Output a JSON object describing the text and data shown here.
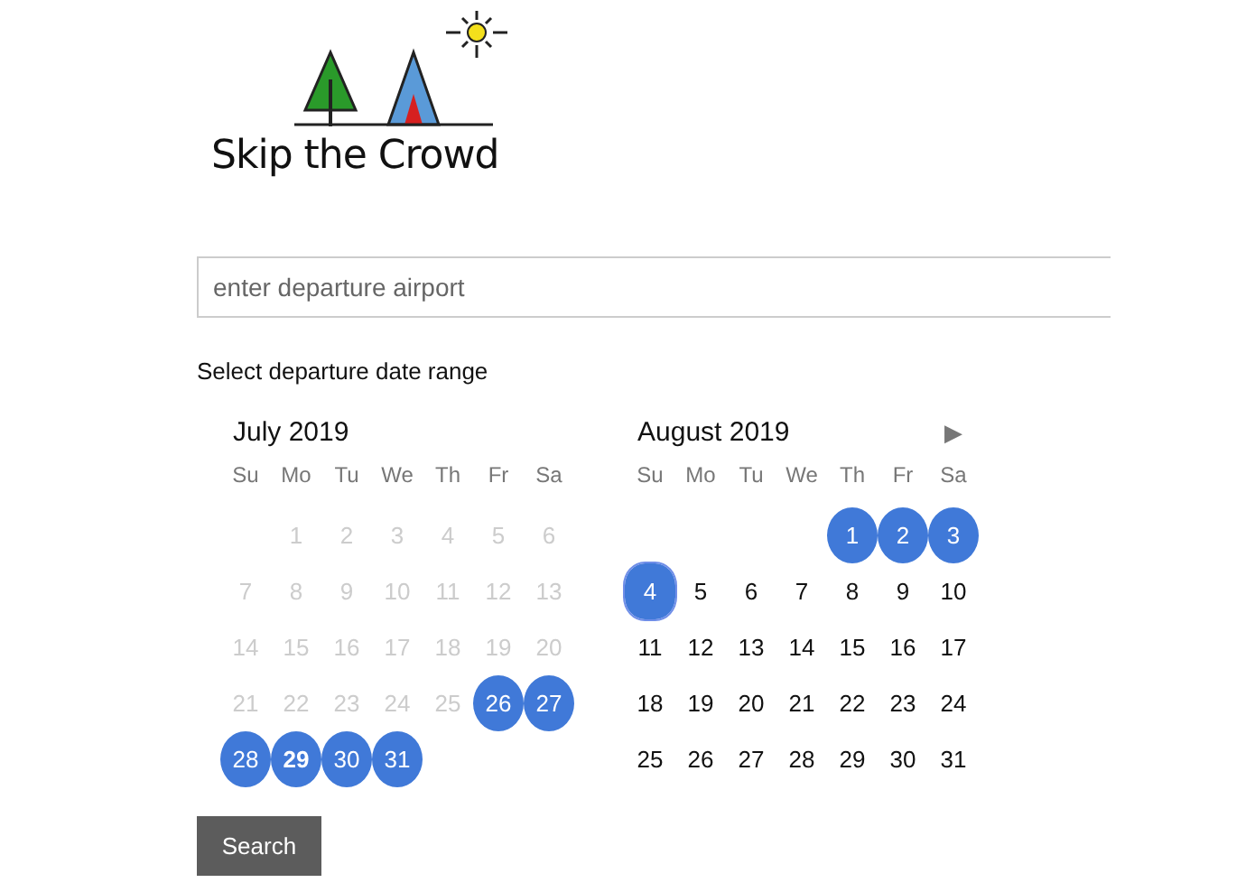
{
  "logo": {
    "text": "Skip the Crowd"
  },
  "airport_field": {
    "placeholder": "enter departure airport"
  },
  "date_label": "Select departure date range",
  "next_button": "▶",
  "months": [
    {
      "title": "July 2019",
      "weekdays": [
        "Su",
        "Mo",
        "Tu",
        "We",
        "Th",
        "Fr",
        "Sa"
      ],
      "weeks": [
        [
          {
            "label": "1",
            "disabled": true,
            "selected": false,
            "today": false,
            "focused": false
          },
          {
            "label": "2",
            "disabled": true,
            "selected": false,
            "today": false,
            "focused": false
          },
          {
            "label": "3",
            "disabled": true,
            "selected": false,
            "today": false,
            "focused": false
          },
          {
            "label": "4",
            "disabled": true,
            "selected": false,
            "today": false,
            "focused": false
          },
          {
            "label": "5",
            "disabled": true,
            "selected": false,
            "today": false,
            "focused": false
          },
          {
            "label": "6",
            "disabled": true,
            "selected": false,
            "today": false,
            "focused": false
          }
        ],
        [
          {
            "label": "7",
            "disabled": true,
            "selected": false,
            "today": false,
            "focused": false
          },
          {
            "label": "8",
            "disabled": true,
            "selected": false,
            "today": false,
            "focused": false
          },
          {
            "label": "9",
            "disabled": true,
            "selected": false,
            "today": false,
            "focused": false
          },
          {
            "label": "10",
            "disabled": true,
            "selected": false,
            "today": false,
            "focused": false
          },
          {
            "label": "11",
            "disabled": true,
            "selected": false,
            "today": false,
            "focused": false
          },
          {
            "label": "12",
            "disabled": true,
            "selected": false,
            "today": false,
            "focused": false
          },
          {
            "label": "13",
            "disabled": true,
            "selected": false,
            "today": false,
            "focused": false
          }
        ],
        [
          {
            "label": "14",
            "disabled": true,
            "selected": false,
            "today": false,
            "focused": false
          },
          {
            "label": "15",
            "disabled": true,
            "selected": false,
            "today": false,
            "focused": false
          },
          {
            "label": "16",
            "disabled": true,
            "selected": false,
            "today": false,
            "focused": false
          },
          {
            "label": "17",
            "disabled": true,
            "selected": false,
            "today": false,
            "focused": false
          },
          {
            "label": "18",
            "disabled": true,
            "selected": false,
            "today": false,
            "focused": false
          },
          {
            "label": "19",
            "disabled": true,
            "selected": false,
            "today": false,
            "focused": false
          },
          {
            "label": "20",
            "disabled": true,
            "selected": false,
            "today": false,
            "focused": false
          }
        ],
        [
          {
            "label": "21",
            "disabled": true,
            "selected": false,
            "today": false,
            "focused": false
          },
          {
            "label": "22",
            "disabled": true,
            "selected": false,
            "today": false,
            "focused": false
          },
          {
            "label": "23",
            "disabled": true,
            "selected": false,
            "today": false,
            "focused": false
          },
          {
            "label": "24",
            "disabled": true,
            "selected": false,
            "today": false,
            "focused": false
          },
          {
            "label": "25",
            "disabled": true,
            "selected": false,
            "today": false,
            "focused": false
          },
          {
            "label": "26",
            "disabled": false,
            "selected": true,
            "today": false,
            "focused": false
          },
          {
            "label": "27",
            "disabled": false,
            "selected": true,
            "today": false,
            "focused": false
          }
        ],
        [
          {
            "label": "28",
            "disabled": false,
            "selected": true,
            "today": false,
            "focused": false
          },
          {
            "label": "29",
            "disabled": false,
            "selected": true,
            "today": true,
            "focused": false
          },
          {
            "label": "30",
            "disabled": false,
            "selected": true,
            "today": false,
            "focused": false
          },
          {
            "label": "31",
            "disabled": false,
            "selected": true,
            "today": false,
            "focused": false
          }
        ]
      ]
    },
    {
      "title": "August 2019",
      "weekdays": [
        "Su",
        "Mo",
        "Tu",
        "We",
        "Th",
        "Fr",
        "Sa"
      ],
      "weeks": [
        [
          {
            "label": "1",
            "disabled": false,
            "selected": true,
            "today": false,
            "focused": false
          },
          {
            "label": "2",
            "disabled": false,
            "selected": true,
            "today": false,
            "focused": false
          },
          {
            "label": "3",
            "disabled": false,
            "selected": true,
            "today": false,
            "focused": false
          }
        ],
        [
          {
            "label": "4",
            "disabled": false,
            "selected": true,
            "today": false,
            "focused": true
          },
          {
            "label": "5",
            "disabled": false,
            "selected": false,
            "today": false,
            "focused": false
          },
          {
            "label": "6",
            "disabled": false,
            "selected": false,
            "today": false,
            "focused": false
          },
          {
            "label": "7",
            "disabled": false,
            "selected": false,
            "today": false,
            "focused": false
          },
          {
            "label": "8",
            "disabled": false,
            "selected": false,
            "today": false,
            "focused": false
          },
          {
            "label": "9",
            "disabled": false,
            "selected": false,
            "today": false,
            "focused": false
          },
          {
            "label": "10",
            "disabled": false,
            "selected": false,
            "today": false,
            "focused": false
          }
        ],
        [
          {
            "label": "11",
            "disabled": false,
            "selected": false,
            "today": false,
            "focused": false
          },
          {
            "label": "12",
            "disabled": false,
            "selected": false,
            "today": false,
            "focused": false
          },
          {
            "label": "13",
            "disabled": false,
            "selected": false,
            "today": false,
            "focused": false
          },
          {
            "label": "14",
            "disabled": false,
            "selected": false,
            "today": false,
            "focused": false
          },
          {
            "label": "15",
            "disabled": false,
            "selected": false,
            "today": false,
            "focused": false
          },
          {
            "label": "16",
            "disabled": false,
            "selected": false,
            "today": false,
            "focused": false
          },
          {
            "label": "17",
            "disabled": false,
            "selected": false,
            "today": false,
            "focused": false
          }
        ],
        [
          {
            "label": "18",
            "disabled": false,
            "selected": false,
            "today": false,
            "focused": false
          },
          {
            "label": "19",
            "disabled": false,
            "selected": false,
            "today": false,
            "focused": false
          },
          {
            "label": "20",
            "disabled": false,
            "selected": false,
            "today": false,
            "focused": false
          },
          {
            "label": "21",
            "disabled": false,
            "selected": false,
            "today": false,
            "focused": false
          },
          {
            "label": "22",
            "disabled": false,
            "selected": false,
            "today": false,
            "focused": false
          },
          {
            "label": "23",
            "disabled": false,
            "selected": false,
            "today": false,
            "focused": false
          },
          {
            "label": "24",
            "disabled": false,
            "selected": false,
            "today": false,
            "focused": false
          }
        ],
        [
          {
            "label": "25",
            "disabled": false,
            "selected": false,
            "today": false,
            "focused": false
          },
          {
            "label": "26",
            "disabled": false,
            "selected": false,
            "today": false,
            "focused": false
          },
          {
            "label": "27",
            "disabled": false,
            "selected": false,
            "today": false,
            "focused": false
          },
          {
            "label": "28",
            "disabled": false,
            "selected": false,
            "today": false,
            "focused": false
          },
          {
            "label": "29",
            "disabled": false,
            "selected": false,
            "today": false,
            "focused": false
          },
          {
            "label": "30",
            "disabled": false,
            "selected": false,
            "today": false,
            "focused": false
          },
          {
            "label": "31",
            "disabled": false,
            "selected": false,
            "today": false,
            "focused": false
          }
        ]
      ]
    }
  ],
  "search_button": "Search"
}
